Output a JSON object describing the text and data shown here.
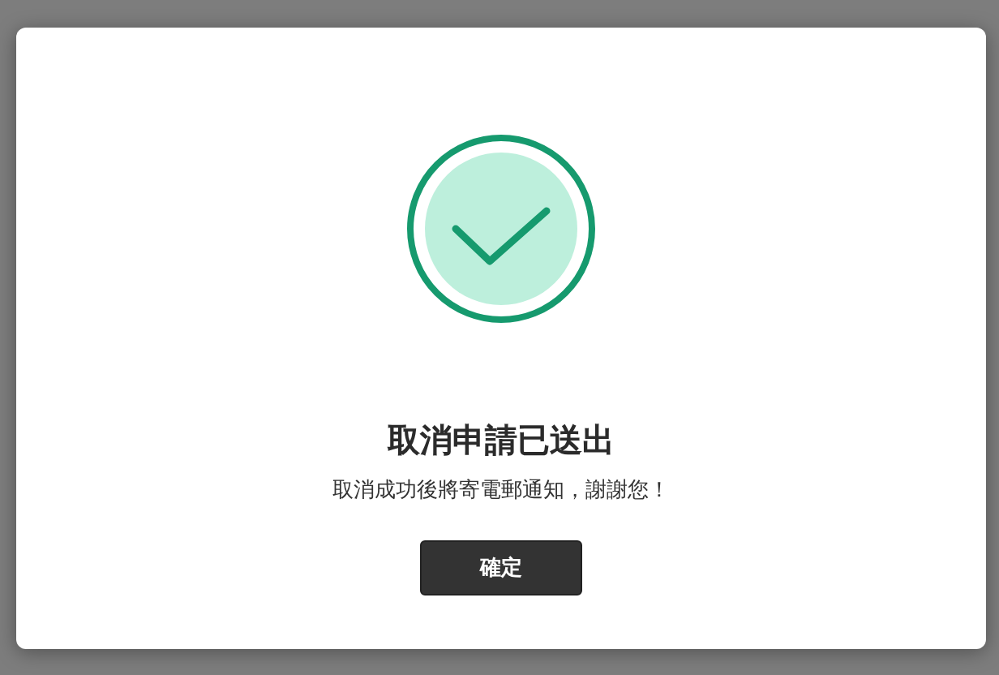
{
  "dialog": {
    "title": "取消申請已送出",
    "message": "取消成功後將寄電郵通知，謝謝您！",
    "buttons": [
      {
        "label": "確定"
      }
    ]
  }
}
